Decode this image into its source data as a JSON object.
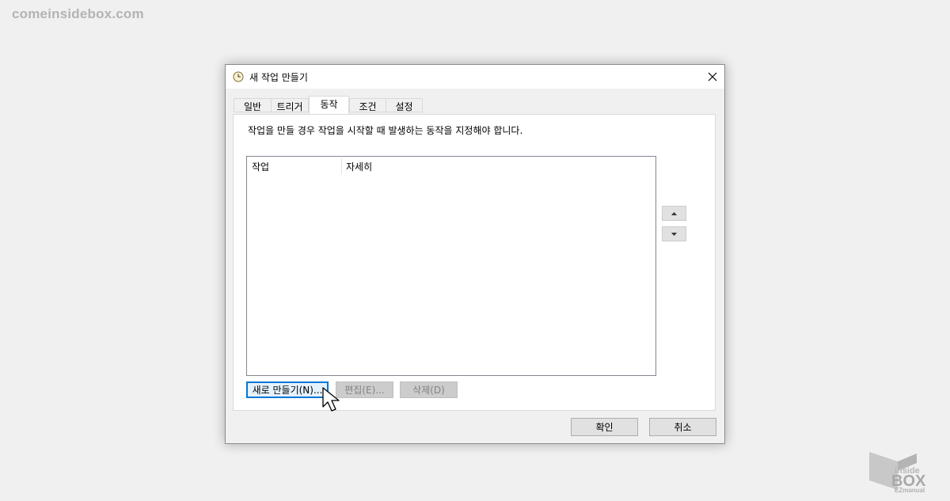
{
  "watermark": "comeinsidebox.com",
  "dialog": {
    "title": "새 작업 만들기",
    "tabs": [
      "일반",
      "트리거",
      "동작",
      "조건",
      "설정"
    ],
    "active_tab": "동작",
    "description": "작업을 만들 경우 작업을 시작할 때 발생하는 동작을 지정해야 합니다.",
    "list_columns": [
      "작업",
      "자세히"
    ],
    "buttons": {
      "new": "새로 만들기(N)...",
      "edit": "편집(E)...",
      "delete": "삭제(D)",
      "ok": "확인",
      "cancel": "취소"
    }
  },
  "logo": {
    "line1": "inside",
    "line2": "BOX",
    "line3": "EZmanual"
  },
  "colors": {
    "focus_border": "#0078d7",
    "background": "#f0f0f0"
  }
}
